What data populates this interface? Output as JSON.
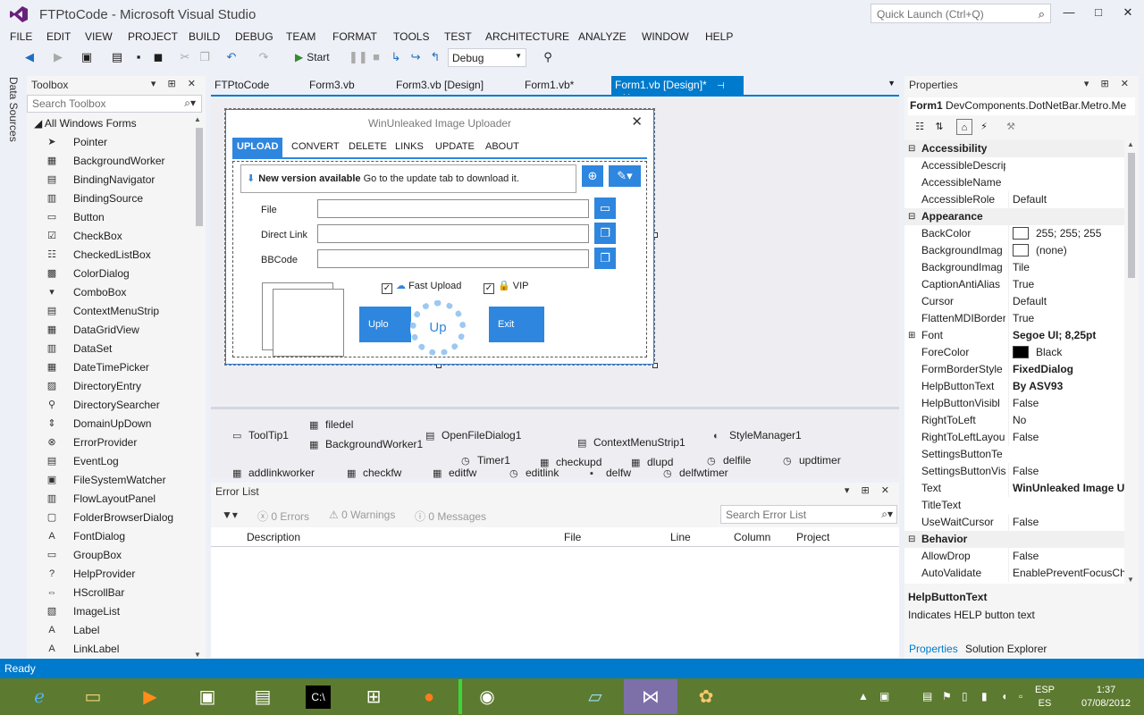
{
  "window": {
    "title": "FTPtoCode - Microsoft Visual Studio",
    "quick_launch_placeholder": "Quick Launch (Ctrl+Q)",
    "minimize": "—",
    "maximize": "□",
    "close": "✕"
  },
  "menu": [
    "FILE",
    "EDIT",
    "VIEW",
    "PROJECT",
    "BUILD",
    "DEBUG",
    "TEAM",
    "FORMAT",
    "TOOLS",
    "TEST",
    "ARCHITECTURE",
    "ANALYZE",
    "WINDOW",
    "HELP"
  ],
  "toolbar": {
    "start_label": "Start",
    "configuration": "Debug"
  },
  "data_sources_tab": "Data Sources",
  "toolbox": {
    "title": "Toolbox",
    "search_placeholder": "Search Toolbox",
    "group": "All Windows Forms",
    "items": [
      {
        "label": "Pointer",
        "icon": "pointer-icon"
      },
      {
        "label": "BackgroundWorker",
        "icon": "backgroundworker-icon"
      },
      {
        "label": "BindingNavigator",
        "icon": "bindingnavigator-icon"
      },
      {
        "label": "BindingSource",
        "icon": "bindingsource-icon"
      },
      {
        "label": "Button",
        "icon": "button-icon"
      },
      {
        "label": "CheckBox",
        "icon": "checkbox-icon"
      },
      {
        "label": "CheckedListBox",
        "icon": "checkedlistbox-icon"
      },
      {
        "label": "ColorDialog",
        "icon": "colordialog-icon"
      },
      {
        "label": "ComboBox",
        "icon": "combobox-icon"
      },
      {
        "label": "ContextMenuStrip",
        "icon": "contextmenustrip-icon"
      },
      {
        "label": "DataGridView",
        "icon": "datagridview-icon"
      },
      {
        "label": "DataSet",
        "icon": "dataset-icon"
      },
      {
        "label": "DateTimePicker",
        "icon": "datetimepicker-icon"
      },
      {
        "label": "DirectoryEntry",
        "icon": "directoryentry-icon"
      },
      {
        "label": "DirectorySearcher",
        "icon": "directorysearcher-icon"
      },
      {
        "label": "DomainUpDown",
        "icon": "domainupdown-icon"
      },
      {
        "label": "ErrorProvider",
        "icon": "errorprovider-icon"
      },
      {
        "label": "EventLog",
        "icon": "eventlog-icon"
      },
      {
        "label": "FileSystemWatcher",
        "icon": "filesystemwatcher-icon"
      },
      {
        "label": "FlowLayoutPanel",
        "icon": "flowlayoutpanel-icon"
      },
      {
        "label": "FolderBrowserDialog",
        "icon": "folderbrowserdialog-icon"
      },
      {
        "label": "FontDialog",
        "icon": "fontdialog-icon"
      },
      {
        "label": "GroupBox",
        "icon": "groupbox-icon"
      },
      {
        "label": "HelpProvider",
        "icon": "helpprovider-icon"
      },
      {
        "label": "HScrollBar",
        "icon": "hscrollbar-icon"
      },
      {
        "label": "ImageList",
        "icon": "imagelist-icon"
      },
      {
        "label": "Label",
        "icon": "label-icon"
      },
      {
        "label": "LinkLabel",
        "icon": "linklabel-icon"
      }
    ]
  },
  "doc_tabs": [
    {
      "label": "FTPtoCode",
      "active": false
    },
    {
      "label": "Form3.vb",
      "active": false
    },
    {
      "label": "Form3.vb [Design]",
      "active": false
    },
    {
      "label": "Form1.vb*",
      "active": false
    },
    {
      "label": "Form1.vb [Design]*",
      "active": true
    }
  ],
  "form": {
    "title": "WinUnleaked Image Uploader",
    "tabs": [
      "UPLOAD",
      "CONVERT",
      "DELETE",
      "LINKS",
      "UPDATE",
      "ABOUT"
    ],
    "notice_bold": "New version available",
    "notice_text": "Go to the update tab to download it.",
    "fields": [
      "File",
      "Direct Link",
      "BBCode"
    ],
    "fast_upload": "Fast Upload",
    "vip": "VIP",
    "upload_btn": "Uplo",
    "spinner_text": "Up",
    "exit_btn": "Exit"
  },
  "tray_components": [
    "ToolTip1",
    "filedel",
    "BackgroundWorker1",
    "OpenFileDialog1",
    "ContextMenuStrip1",
    "StyleManager1",
    "Timer1",
    "checkupd",
    "dlupd",
    "delfile",
    "updtimer",
    "addlinkworker",
    "checkfw",
    "editfw",
    "editlink",
    "delfw",
    "delfwtimer"
  ],
  "error_list": {
    "title": "Error List",
    "errors": "0 Errors",
    "warnings": "0 Warnings",
    "messages": "0 Messages",
    "search_placeholder": "Search Error List",
    "columns": [
      "Description",
      "File",
      "Line",
      "Column",
      "Project"
    ]
  },
  "properties": {
    "title": "Properties",
    "object_name": "Form1",
    "object_type": "DevComponents.DotNetBar.Metro.Me",
    "rows": [
      {
        "type": "cat",
        "name": "Accessibility"
      },
      {
        "type": "prop",
        "name": "AccessibleDescrip",
        "value": ""
      },
      {
        "type": "prop",
        "name": "AccessibleName",
        "value": ""
      },
      {
        "type": "prop",
        "name": "AccessibleRole",
        "value": "Default"
      },
      {
        "type": "cat",
        "name": "Appearance"
      },
      {
        "type": "prop",
        "name": "BackColor",
        "value": "255; 255; 255",
        "swatch": "#ffffff"
      },
      {
        "type": "prop",
        "name": "BackgroundImag",
        "value": "(none)",
        "swatch": "#ffffff"
      },
      {
        "type": "prop",
        "name": "BackgroundImag",
        "value": "Tile"
      },
      {
        "type": "prop",
        "name": "CaptionAntiAlias",
        "value": "True"
      },
      {
        "type": "prop",
        "name": "Cursor",
        "value": "Default"
      },
      {
        "type": "prop",
        "name": "FlattenMDIBorder",
        "value": "True"
      },
      {
        "type": "prop",
        "name": "Font",
        "value": "Segoe UI; 8,25pt",
        "bold": true,
        "expandable": true
      },
      {
        "type": "prop",
        "name": "ForeColor",
        "value": "Black",
        "swatch": "#000000"
      },
      {
        "type": "prop",
        "name": "FormBorderStyle",
        "value": "FixedDialog",
        "bold": true
      },
      {
        "type": "prop",
        "name": "HelpButtonText",
        "value": "By ASV93",
        "bold": true
      },
      {
        "type": "prop",
        "name": "HelpButtonVisibl",
        "value": "False"
      },
      {
        "type": "prop",
        "name": "RightToLeft",
        "value": "No"
      },
      {
        "type": "prop",
        "name": "RightToLeftLayou",
        "value": "False"
      },
      {
        "type": "prop",
        "name": "SettingsButtonTe",
        "value": ""
      },
      {
        "type": "prop",
        "name": "SettingsButtonVis",
        "value": "False"
      },
      {
        "type": "prop",
        "name": "Text",
        "value": "WinUnleaked Image Up",
        "bold": true
      },
      {
        "type": "prop",
        "name": "TitleText",
        "value": ""
      },
      {
        "type": "prop",
        "name": "UseWaitCursor",
        "value": "False"
      },
      {
        "type": "cat",
        "name": "Behavior"
      },
      {
        "type": "prop",
        "name": "AllowDrop",
        "value": "False"
      },
      {
        "type": "prop",
        "name": "AutoValidate",
        "value": "EnablePreventFocusCha"
      }
    ],
    "desc_title": "HelpButtonText",
    "desc_text": "Indicates HELP button text",
    "tab_properties": "Properties",
    "tab_solution": "Solution Explorer"
  },
  "status": "Ready",
  "system_tray": {
    "lang_top": "ESP",
    "lang_bottom": "ES",
    "time": "1:37",
    "date": "07/08/2012"
  },
  "colors": {
    "accent": "#007acc",
    "form_accent": "#2e86de",
    "taskbar": "#5c7a30"
  }
}
